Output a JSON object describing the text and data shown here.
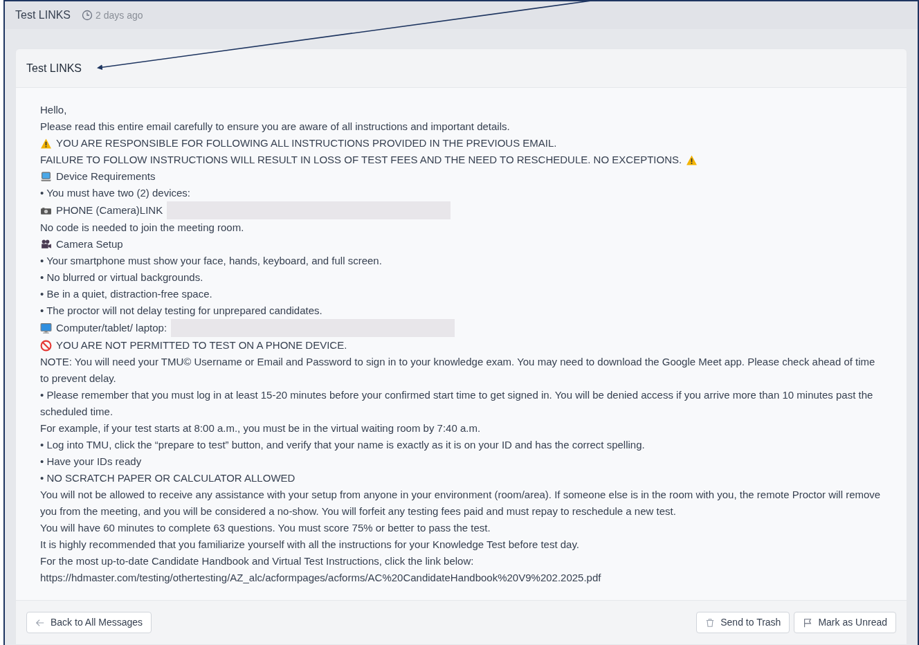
{
  "header": {
    "title": "Test LINKS",
    "time": "2 days ago"
  },
  "message": {
    "subject": "Test LINKS",
    "lines": [
      {
        "kind": "text",
        "text": "Hello,"
      },
      {
        "kind": "text",
        "text": "Please read this entire email carefully to ensure you are aware of all instructions and important details."
      },
      {
        "kind": "warning",
        "text": "YOU ARE RESPONSIBLE FOR FOLLOWING ALL INSTRUCTIONS PROVIDED IN THE PREVIOUS EMAIL."
      },
      {
        "kind": "warning-after",
        "text": "FAILURE TO FOLLOW INSTRUCTIONS WILL RESULT IN LOSS OF TEST FEES AND THE NEED TO RESCHEDULE. NO EXCEPTIONS."
      },
      {
        "kind": "laptop",
        "text": "Device Requirements"
      },
      {
        "kind": "text",
        "text": "• You must have two (2) devices:"
      },
      {
        "kind": "camera",
        "text": "PHONE (Camera)LINK",
        "redacted": true
      },
      {
        "kind": "text",
        "text": "No code is needed to join the meeting room."
      },
      {
        "kind": "video-camera",
        "text": "Camera Setup"
      },
      {
        "kind": "text",
        "text": "• Your smartphone must show your face, hands, keyboard, and full screen."
      },
      {
        "kind": "text",
        "text": "• No blurred or virtual backgrounds."
      },
      {
        "kind": "text",
        "text": "• Be in a quiet, distraction-free space."
      },
      {
        "kind": "text",
        "text": "• The proctor will not delay testing for unprepared candidates."
      },
      {
        "kind": "desktop",
        "text": "Computer/tablet/ laptop:",
        "redacted": true
      },
      {
        "kind": "prohibited",
        "text": "YOU ARE NOT PERMITTED TO TEST ON A PHONE DEVICE."
      },
      {
        "kind": "text",
        "text": "NOTE: You will need your TMU© Username or Email and Password to sign in to your knowledge exam. You may need to download the Google Meet app. Please check ahead of time to prevent delay."
      },
      {
        "kind": "text",
        "text": "• Please remember that you must log in at least 15-20 minutes before your confirmed start time to get signed in. You will be denied access if you arrive more than 10 minutes past the scheduled time."
      },
      {
        "kind": "text",
        "text": "For example, if your test starts at 8:00 a.m., you must be in the virtual waiting room by 7:40 a.m."
      },
      {
        "kind": "text",
        "text": "• Log into TMU, click the “prepare to test” button, and verify that your name is exactly as it is on your ID and has the correct spelling."
      },
      {
        "kind": "text",
        "text": "• Have your IDs ready"
      },
      {
        "kind": "text",
        "text": "• NO SCRATCH PAPER OR CALCULATOR ALLOWED"
      },
      {
        "kind": "text",
        "text": "You will not be allowed to receive any assistance with your setup from anyone in your environment (room/area). If someone else is in the room with you, the remote Proctor will remove you from the meeting, and you will be considered a no-show. You will forfeit any testing fees paid and must repay to reschedule a new test."
      },
      {
        "kind": "text",
        "text": "You will have 60 minutes to complete 63 questions. You must score 75% or better to pass the test."
      },
      {
        "kind": "text",
        "text": "It is highly recommended that you familiarize yourself with all the instructions for your Knowledge Test before test day."
      },
      {
        "kind": "text",
        "text": "For the most up-to-date Candidate Handbook and Virtual Test Instructions, click the link below:"
      },
      {
        "kind": "text",
        "text": "https://hdmaster.com/testing/othertesting/AZ_alc/acformpages/acforms/AC%20CandidateHandbook%20V9%202.2025.pdf"
      }
    ]
  },
  "footer": {
    "back": "Back to All Messages",
    "trash": "Send to Trash",
    "unread": "Mark as Unread"
  }
}
